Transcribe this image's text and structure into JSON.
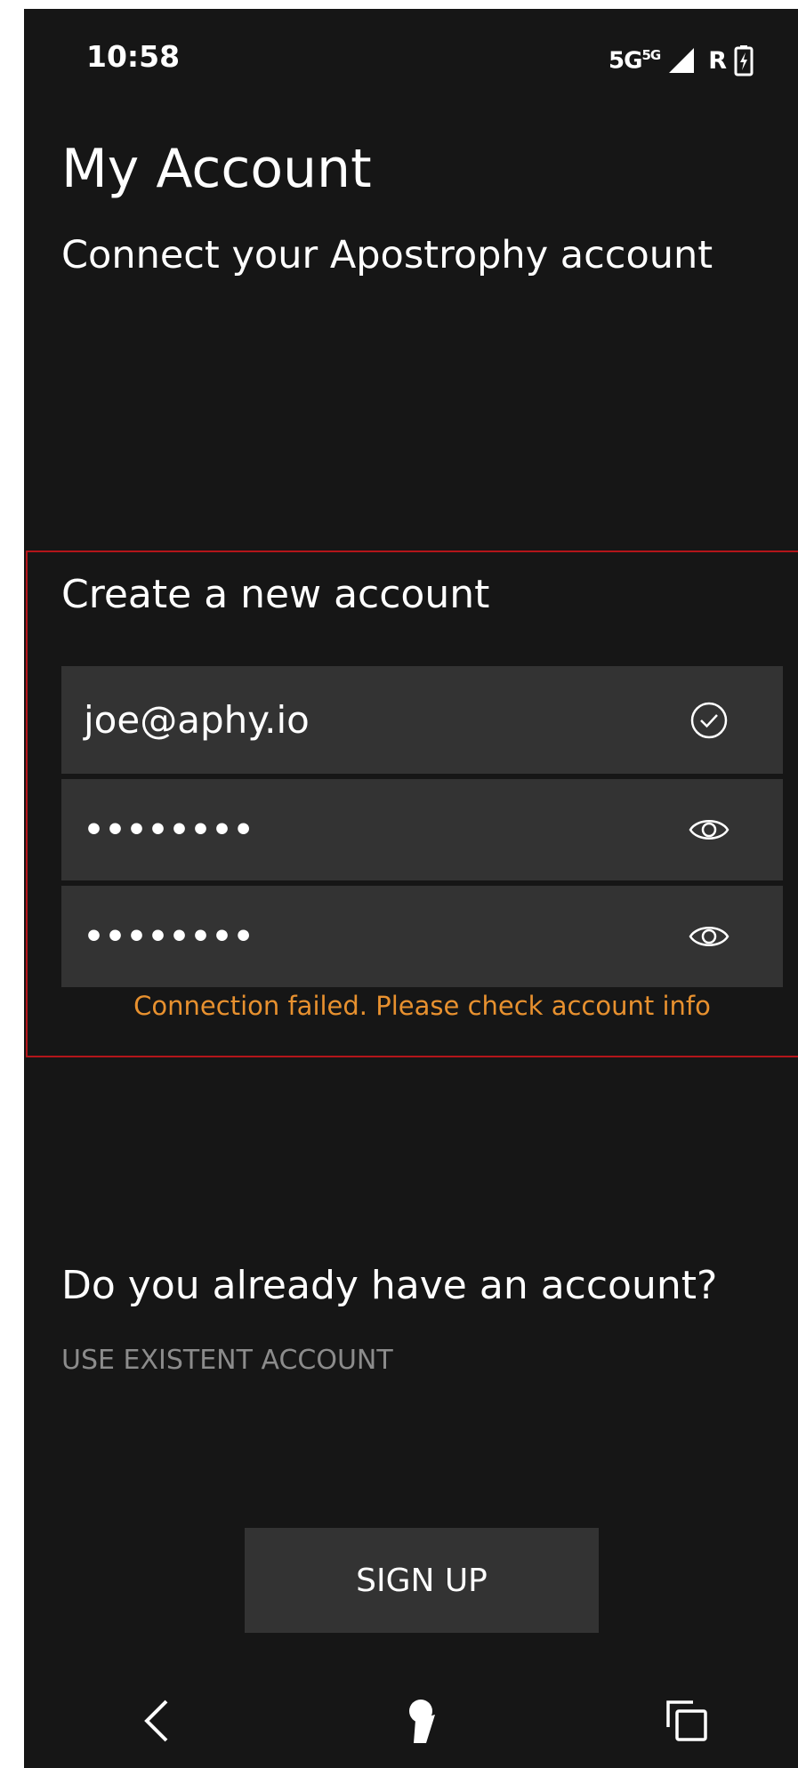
{
  "status_bar": {
    "time": "10:58",
    "network": "5G",
    "network_sup": "5G",
    "roaming": "R"
  },
  "header": {
    "title": "My Account",
    "subtitle": "Connect your Apostrophy account"
  },
  "create_account": {
    "heading": "Create a new account",
    "email_value": "joe@aphy.io",
    "password_value": "••••••••",
    "confirm_password_value": "••••••••",
    "error_message": "Connection failed. Please check account info",
    "error_color": "#e8912f",
    "highlight_border_color": "#b3151a"
  },
  "existing_account": {
    "heading": "Do you already have an account?",
    "link_label": "USE EXISTENT ACCOUNT"
  },
  "actions": {
    "signup_label": "SIGN UP"
  },
  "nav_bar": {
    "items": [
      "back-icon",
      "home-icon",
      "recent-apps-icon"
    ]
  }
}
